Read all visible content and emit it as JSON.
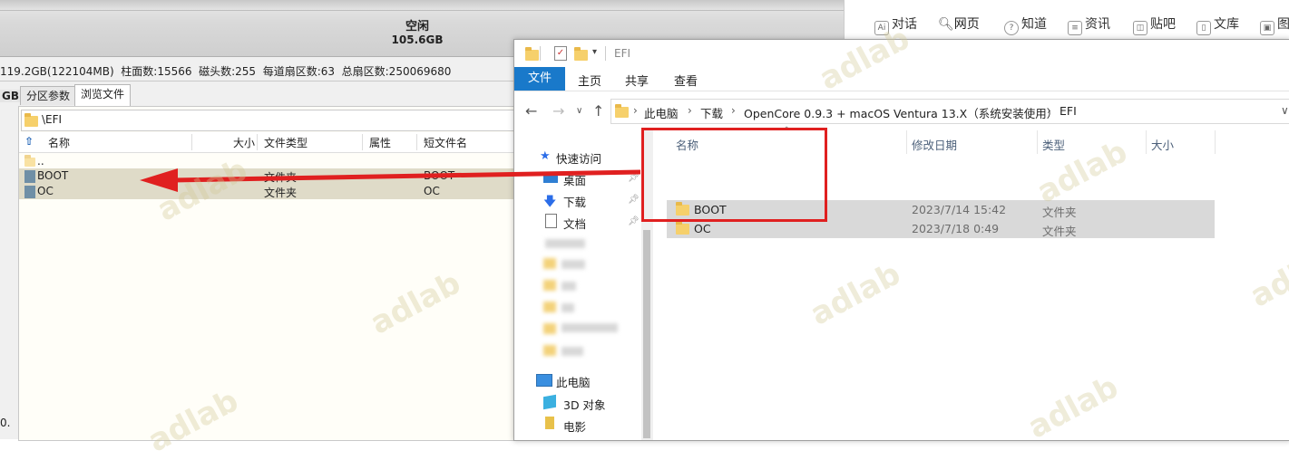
{
  "left_app": {
    "free_label": "空闲",
    "free_size": "105.6GB",
    "disk_info": "119.2GB(122104MB)  柱面数:15566  磁头数:255  每道扇区数:63  总扇区数:250069680",
    "gb_label": "GB",
    "tabs": [
      "分区参数",
      "浏览文件"
    ],
    "path": "\\EFI",
    "columns": [
      "名称",
      "大小",
      "文件类型",
      "属性",
      "短文件名"
    ],
    "rows": [
      {
        "name": "..",
        "size": "",
        "type": "",
        "attr": "",
        "short": ""
      },
      {
        "name": "BOOT",
        "size": "",
        "type": "文件夹",
        "attr": "",
        "short": "BOOT"
      },
      {
        "name": "OC",
        "size": "",
        "type": "文件夹",
        "attr": "",
        "short": "OC"
      }
    ],
    "bottom_left_text": "0."
  },
  "browser": {
    "tabs": [
      "对话",
      "网页",
      "知道",
      "资讯",
      "贴吧",
      "文库",
      "图"
    ],
    "active_tab": "网页"
  },
  "explorer": {
    "title": "EFI",
    "ribbon_tabs": [
      "文件",
      "主页",
      "共享",
      "查看"
    ],
    "breadcrumb": [
      "此电脑",
      "下载",
      "OpenCore 0.9.3 + macOS Ventura 13.X（系统安装使用）",
      "EFI"
    ],
    "nav_items": [
      "快速访问",
      "桌面",
      "下载",
      "文档",
      "此电脑",
      "3D 对象",
      "电影"
    ],
    "columns": [
      "名称",
      "修改日期",
      "类型",
      "大小"
    ],
    "files": [
      {
        "name": "BOOT",
        "date": "2023/7/14 15:42",
        "type": "文件夹",
        "size": ""
      },
      {
        "name": "OC",
        "date": "2023/7/18 0:49",
        "type": "文件夹",
        "size": ""
      }
    ]
  },
  "watermark": "adlab",
  "colors": {
    "accent": "#1979ca",
    "annotation": "#e02020",
    "selected_row": "#d9d9d9"
  }
}
